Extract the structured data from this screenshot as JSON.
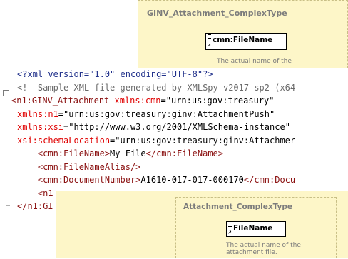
{
  "top_schema": {
    "title": "GINV_Attachment_ComplexType",
    "element_label": "cmn:FileName",
    "annotation": "The actual name of the"
  },
  "code": {
    "lines": [
      [
        {
          "t": "<?xml version=\"1.0\" encoding=\"UTF-8\"?>",
          "c": "c-pi"
        }
      ],
      [
        {
          "t": "<!--Sample XML file generated by XMLSpy v2017 sp2 (x64",
          "c": "c-comment"
        }
      ],
      [
        {
          "t": "<n1:GINV_Attachment ",
          "c": "c-tag"
        },
        {
          "t": "xmlns:cmn",
          "c": "c-attr"
        },
        {
          "t": "=\"urn:us:gov:treasury\"",
          "c": "c-val"
        }
      ],
      [
        {
          "t": "xmlns:n1",
          "c": "c-attr"
        },
        {
          "t": "=\"urn:us:gov:treasury:ginv:AttachmentPush\"",
          "c": "c-val"
        }
      ],
      [
        {
          "t": "xmlns:xsi",
          "c": "c-attr"
        },
        {
          "t": "=\"http://www.w3.org/2001/XMLSchema-instance\"",
          "c": "c-val"
        }
      ],
      [
        {
          "t": "xsi:schemaLocation",
          "c": "c-attr"
        },
        {
          "t": "=\"urn:us:gov:treasury:ginv:Attachmer",
          "c": "c-val"
        }
      ],
      [
        {
          "t": "    <cmn:FileName>",
          "c": "c-tag"
        },
        {
          "t": "My File",
          "c": "c-text"
        },
        {
          "t": "</cmn:FileName>",
          "c": "c-tag"
        }
      ],
      [
        {
          "t": "    <cmn:FileNameAlias/>",
          "c": "c-tag"
        }
      ],
      [
        {
          "t": "    <cmn:DocumentNumber>",
          "c": "c-tag"
        },
        {
          "t": "A1610-017-017-000170",
          "c": "c-text"
        },
        {
          "t": "</cmn:Docu",
          "c": "c-tag"
        }
      ],
      [
        {
          "t": "    <n1",
          "c": "c-tag"
        }
      ],
      [
        {
          "t": "</n1:GI",
          "c": "c-tag"
        }
      ]
    ]
  },
  "bottom_schema": {
    "title": "Attachment_ComplexType",
    "element_label": "FileName",
    "annotation_lines": [
      "The actual name of the",
      "attachment file."
    ]
  },
  "colors": {
    "schema_bg": "#fdf6c8",
    "tag": "#8a1010",
    "attr": "#e00000",
    "comment": "#6a6a6a",
    "pi": "#1f2f8a"
  }
}
